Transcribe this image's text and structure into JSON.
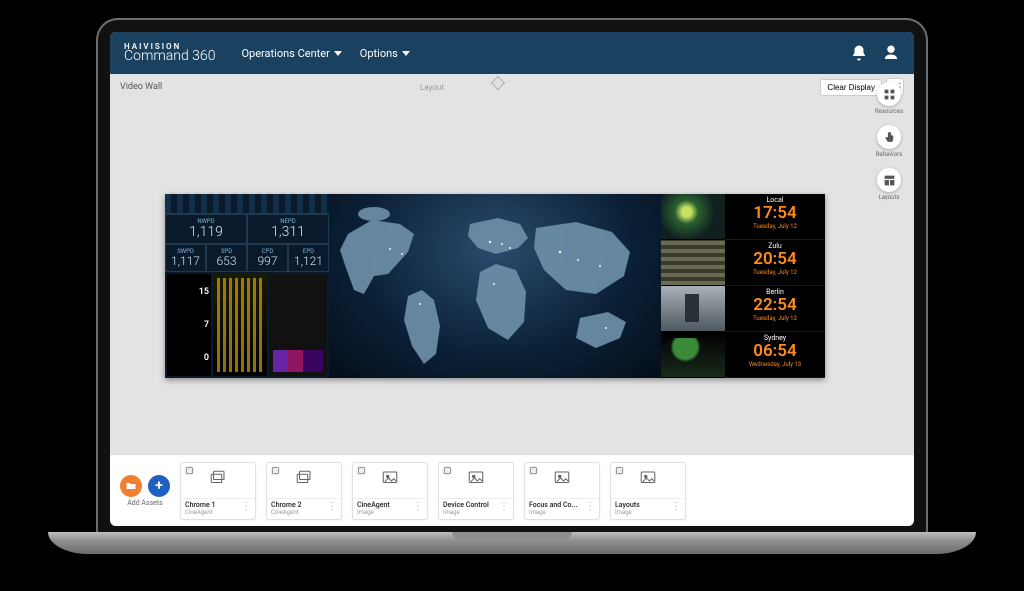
{
  "brand": {
    "top": "HAIVISION",
    "name": "Command 360"
  },
  "menu": {
    "ops": "Operations Center",
    "options": "Options"
  },
  "subheader": {
    "videowall": "Video Wall",
    "layout": "Layout",
    "clear": "Clear Display"
  },
  "sideActions": {
    "resources": "Resources",
    "behaviors": "Behaviors",
    "layouts": "Layouts"
  },
  "dash": {
    "row1": [
      {
        "label": "NWPD",
        "value": "1,119"
      },
      {
        "label": "NEPD",
        "value": "1,311"
      }
    ],
    "row2": [
      {
        "label": "SWPD",
        "value": "1,117"
      },
      {
        "label": "SPD",
        "value": "653"
      },
      {
        "label": "CPD",
        "value": "997"
      },
      {
        "label": "EPD",
        "value": "1,121"
      }
    ],
    "counts": [
      "15",
      "7",
      "0"
    ]
  },
  "clocks": [
    {
      "city": "Local",
      "time": "17:54",
      "date": "Tuesday, July 12"
    },
    {
      "city": "Zulu",
      "time": "20:54",
      "date": "Tuesday, July 12"
    },
    {
      "city": "Berlin",
      "time": "22:54",
      "date": "Tuesday, July 12"
    },
    {
      "city": "Sydney",
      "time": "06:54",
      "date": "Wednesday, July 13"
    }
  ],
  "assets": {
    "addLabel": "Add Assets",
    "items": [
      {
        "name": "Chrome 1",
        "sub": "CineAgent",
        "icon": "stack"
      },
      {
        "name": "Chrome 2",
        "sub": "CineAgent",
        "icon": "stack"
      },
      {
        "name": "CineAgent",
        "sub": "Image",
        "icon": "image"
      },
      {
        "name": "Device Control",
        "sub": "Image",
        "icon": "image"
      },
      {
        "name": "Focus and Co...",
        "sub": "Image",
        "icon": "image"
      },
      {
        "name": "Layouts",
        "sub": "Image",
        "icon": "image"
      }
    ]
  }
}
